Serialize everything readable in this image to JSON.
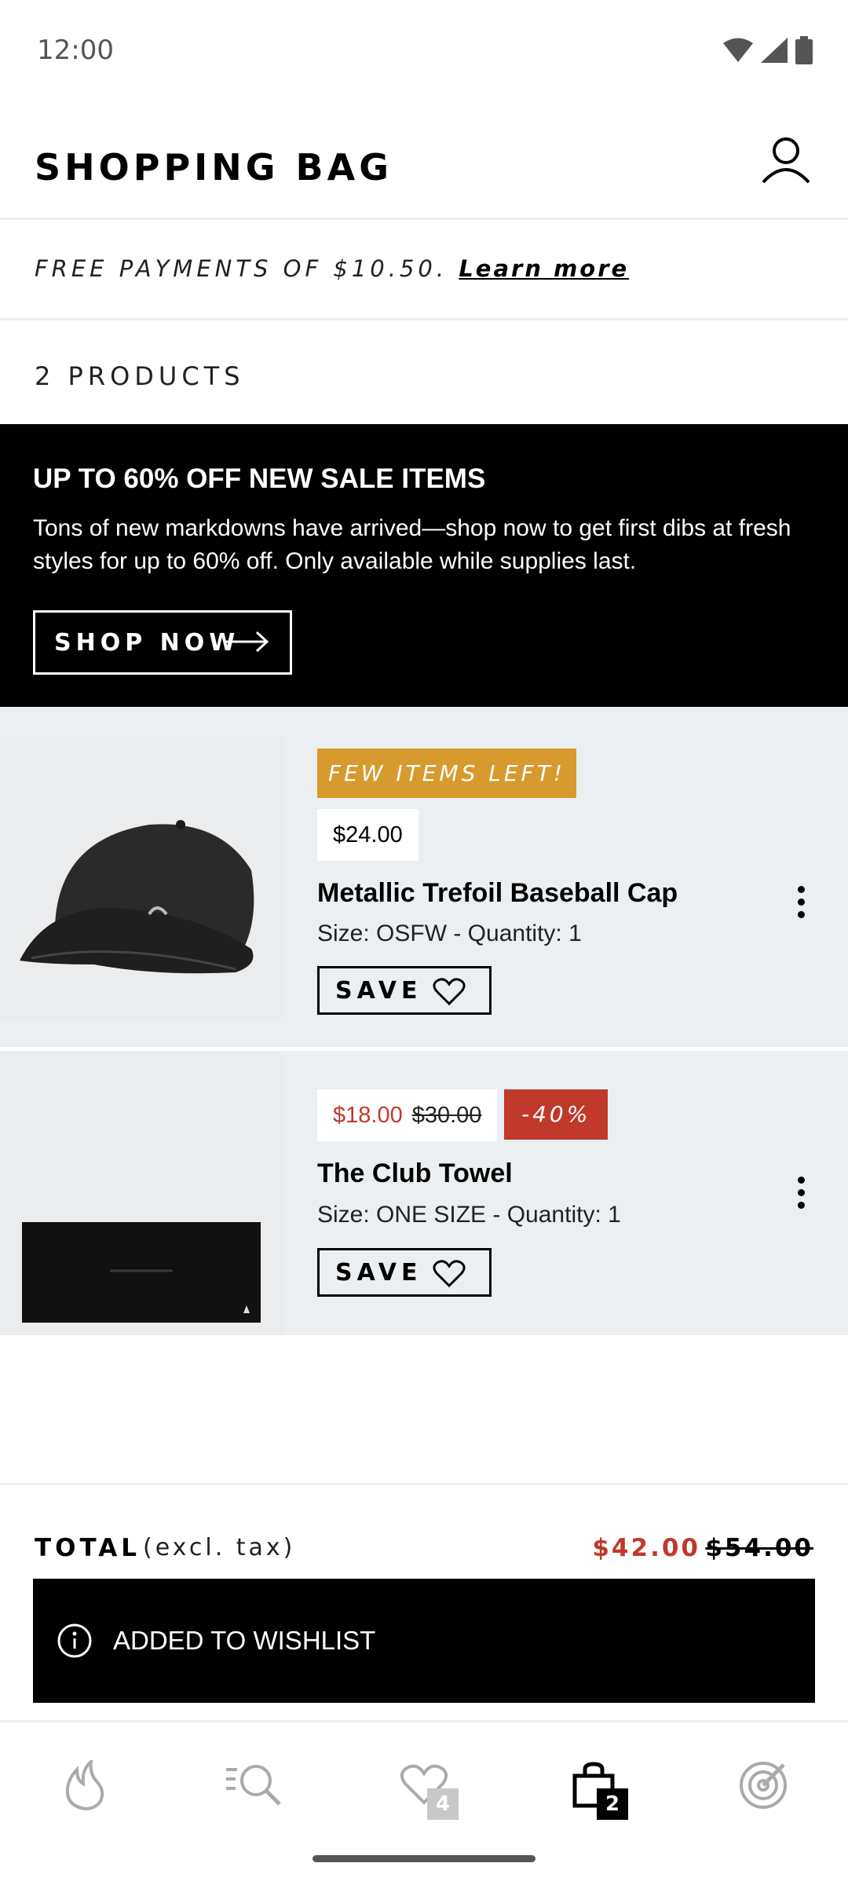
{
  "status_bar": {
    "time": "12:00"
  },
  "header": {
    "title": "SHOPPING BAG"
  },
  "promo_strip": {
    "text": "FREE PAYMENTS OF $10.50.",
    "link": "Learn more"
  },
  "bag": {
    "count_label": "2 PRODUCTS"
  },
  "sale_banner": {
    "title": "UP TO 60% OFF NEW SALE ITEMS",
    "body": "Tons of new markdowns have arrived—shop now to get first dibs at fresh styles for up to 60% off. Only available while supplies last.",
    "cta": "SHOP NOW"
  },
  "products": [
    {
      "badge": "FEW ITEMS LEFT!",
      "price": "$24.00",
      "name": "Metallic Trefoil Baseball Cap",
      "meta": "Size: OSFW - Quantity: 1",
      "save_label": "SAVE"
    },
    {
      "sale_price": "$18.00",
      "original_price": "$30.00",
      "discount": "-40%",
      "name": "The Club Towel",
      "meta": "Size: ONE SIZE - Quantity: 1",
      "save_label": "SAVE"
    }
  ],
  "total": {
    "label": "TOTAL",
    "note": "(excl. tax)",
    "sale_total": "$42.00",
    "original_total": "$54.00"
  },
  "toast": {
    "message": "ADDED TO WISHLIST",
    "icon": "info-icon"
  },
  "bottom_nav": {
    "items": [
      {
        "icon": "flame-icon"
      },
      {
        "icon": "search-list-icon"
      },
      {
        "icon": "heart-icon",
        "badge": "4"
      },
      {
        "icon": "bag-icon",
        "badge": "2",
        "active": true
      },
      {
        "icon": "radar-icon"
      }
    ]
  },
  "colors": {
    "sale_red": "#c0392b",
    "few_items_badge": "#d69a2e",
    "product_bg": "#eceff1",
    "banner_bg": "#000000"
  }
}
